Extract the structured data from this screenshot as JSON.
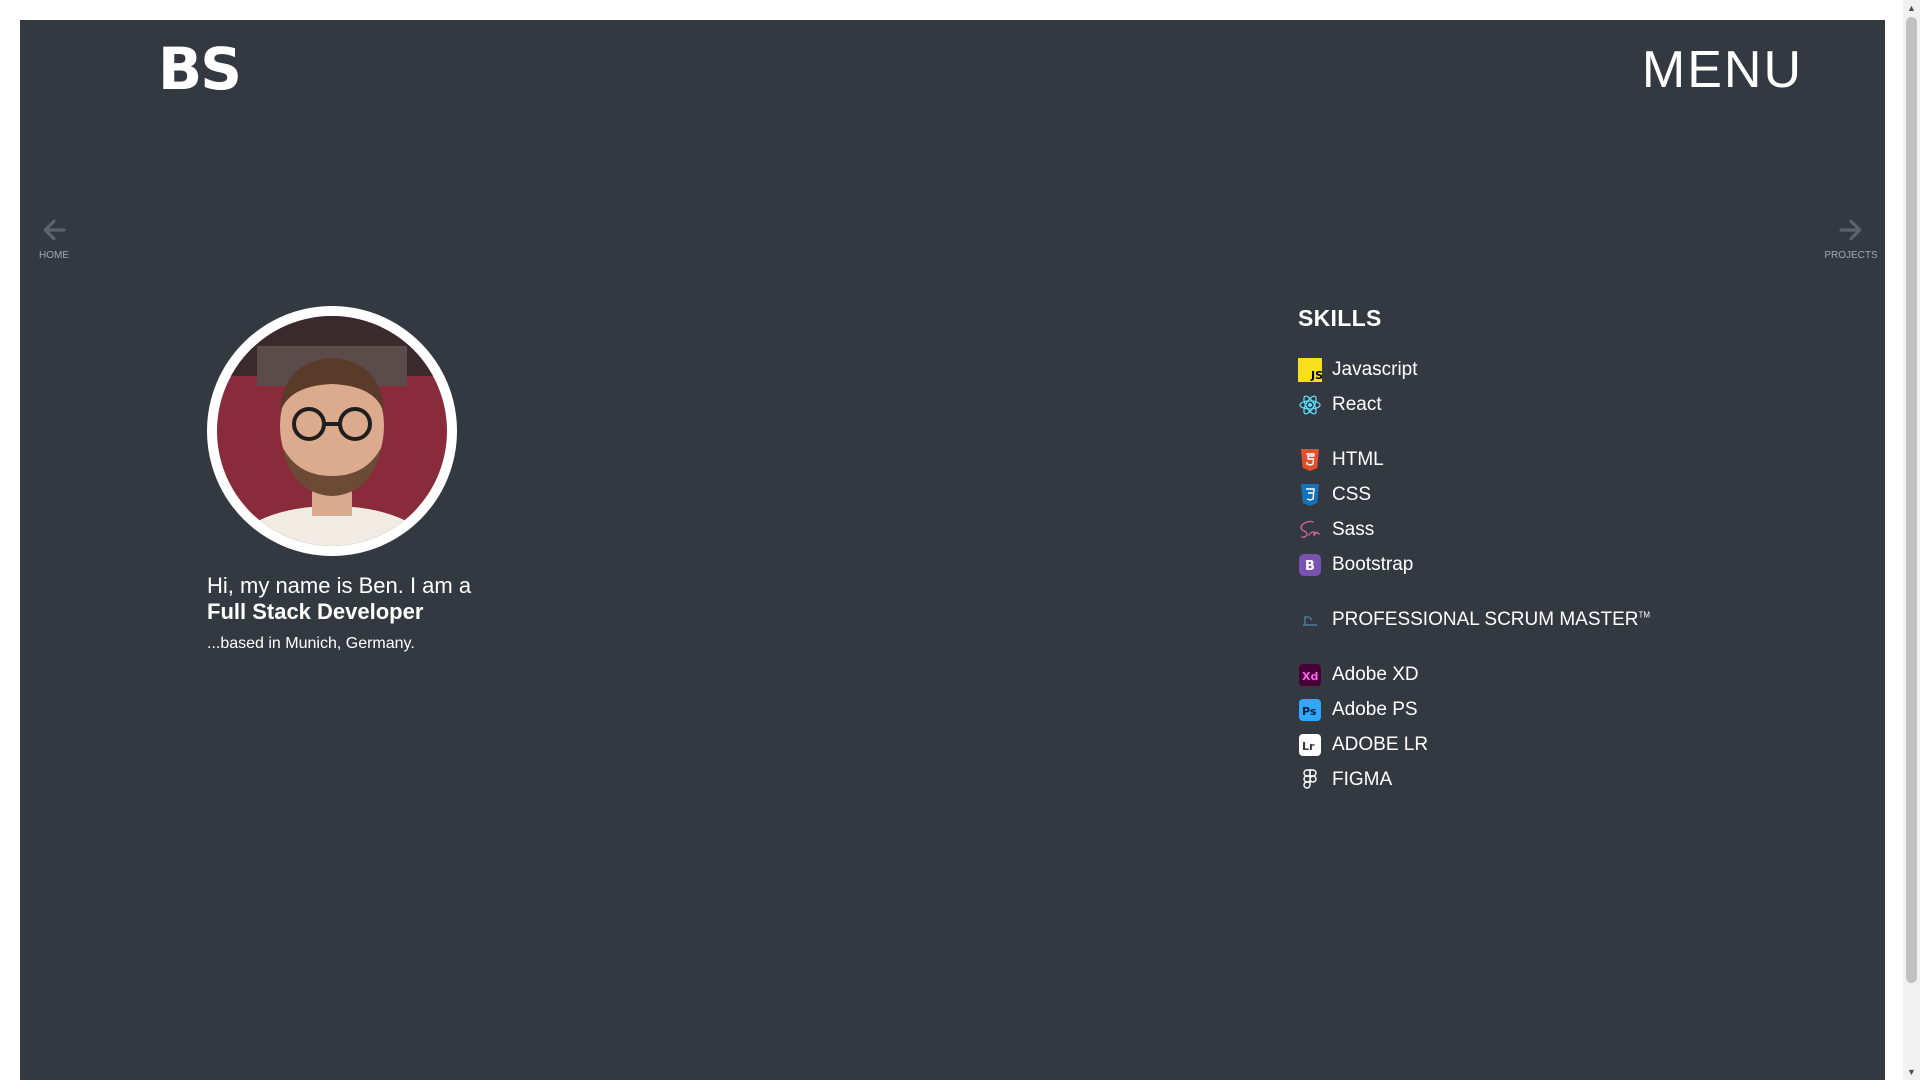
{
  "brand": {
    "logo": "BS"
  },
  "header": {
    "menu_label": "MENU"
  },
  "nav": {
    "prev_label": "HOME",
    "next_label": "PROJECTS"
  },
  "intro": {
    "greeting": "Hi, my name is Ben. I am a",
    "role": "Full Stack Developer",
    "location": "...based in Munich, Germany."
  },
  "skills": {
    "title": "SKILLS",
    "groups": [
      {
        "items": [
          {
            "label": "Javascript",
            "icon": "javascript-icon",
            "color": "#f7df1e"
          },
          {
            "label": "React",
            "icon": "react-icon",
            "color": "#61dafb"
          }
        ]
      },
      {
        "items": [
          {
            "label": "HTML",
            "icon": "html5-icon",
            "color": "#e34f26"
          },
          {
            "label": "CSS",
            "icon": "css3-icon",
            "color": "#1572b6"
          },
          {
            "label": "Sass",
            "icon": "sass-icon",
            "color": "#cc6699"
          },
          {
            "label": "Bootstrap",
            "icon": "bootstrap-icon",
            "color": "#7952b3"
          }
        ]
      },
      {
        "items": [
          {
            "label": "PROFESSIONAL SCRUM MASTER",
            "trademark": "TM",
            "icon": "scrum-icon",
            "color": "#4c8aa8"
          }
        ]
      },
      {
        "items": [
          {
            "label": "Adobe XD",
            "icon": "adobe-xd-icon",
            "color": "#ff61f6"
          },
          {
            "label": "Adobe PS",
            "icon": "adobe-ps-icon",
            "color": "#31a8ff"
          },
          {
            "label": "ADOBE LR",
            "icon": "adobe-lr-icon",
            "color": "#ffffff"
          },
          {
            "label": "FIGMA",
            "icon": "figma-icon",
            "color": "#ffffff"
          }
        ]
      }
    ]
  },
  "theme": {
    "background": "#343941",
    "text": "#ffffff",
    "muted_arrow": "#5d626b"
  }
}
